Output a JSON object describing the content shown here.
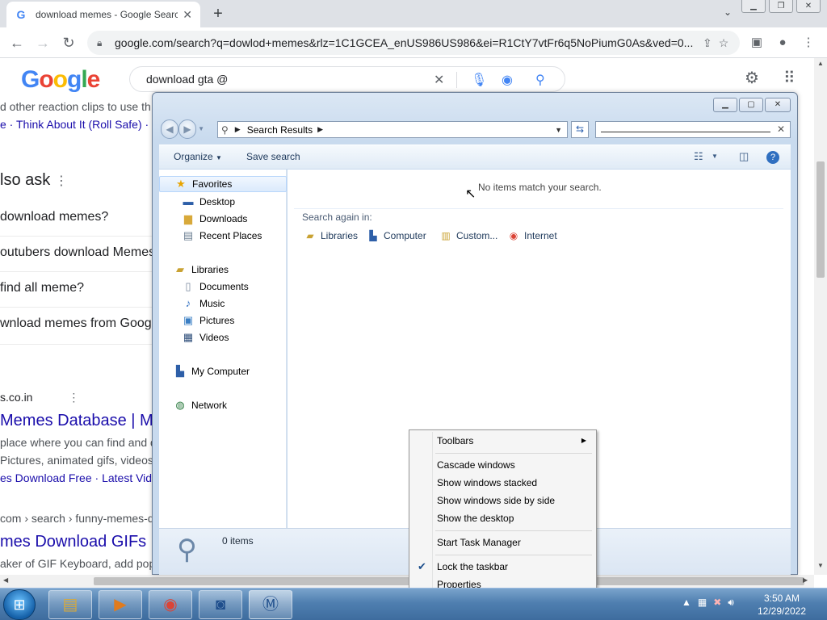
{
  "chrome": {
    "tab_title": "download memes - Google Search",
    "tab_close": "✕",
    "new_tab": "+",
    "url": "google.com/search?q=dowlod+memes&rlz=1C1GCEA_enUS986US986&ei=R1CtY7vtFr6q5NoPiumG0As&ved=0..."
  },
  "google": {
    "logo_letters": [
      "G",
      "o",
      "o",
      "g",
      "l",
      "e"
    ],
    "query": "download gta @",
    "results": {
      "line1": "d other reaction clips to use th",
      "line2_a": "e",
      "line2_b": "Think About It (Roll Safe)",
      "line2_c": "· W",
      "people_also_ask": "lso ask",
      "q1": "download memes?",
      "q2": "outubers download Memes",
      "q3": "find all meme?",
      "q4": "wnload memes from Goog",
      "site1": "s.co.in",
      "title1": "Memes Database | Me",
      "snip1": " place where you can find and d",
      "snip2": "Pictures, animated gifs, videos",
      "sitelinks1_a": "es Download Free",
      "sitelinks1_b": "· Latest Vide",
      "cite2": "com › search › funny-memes-do",
      "title2": "mes Download GIFs |",
      "snip3": "aker of GIF Keyboard, add popu"
    }
  },
  "explorer": {
    "breadcrumb": "Search Results",
    "search_value": "",
    "commands": {
      "organize": "Organize",
      "save_search": "Save search"
    },
    "nav": {
      "favorites": "Favorites",
      "desktop": "Desktop",
      "downloads": "Downloads",
      "recent": "Recent Places",
      "libraries": "Libraries",
      "documents": "Documents",
      "music": "Music",
      "pictures": "Pictures",
      "videos": "Videos",
      "computer": "My Computer",
      "network": "Network"
    },
    "no_match": "No items match your search.",
    "search_again": "Search again in:",
    "locations": {
      "libraries": "Libraries",
      "computer": "Computer",
      "custom": "Custom...",
      "internet": "Internet"
    },
    "item_count": "0 items"
  },
  "context_menu": {
    "toolbars": "Toolbars",
    "cascade": "Cascade windows",
    "stacked": "Show windows stacked",
    "side_by_side": "Show windows side by side",
    "show_desktop": "Show the desktop",
    "task_manager": "Start Task Manager",
    "lock_taskbar": "Lock the taskbar",
    "lock_checked": true,
    "properties": "Properties"
  },
  "taskbar": {
    "time": "3:50 AM",
    "date": "12/29/2022"
  },
  "colors": {
    "link": "#1a0dab",
    "taskbar": "#4f7fb0",
    "accent": "#4285f4"
  }
}
